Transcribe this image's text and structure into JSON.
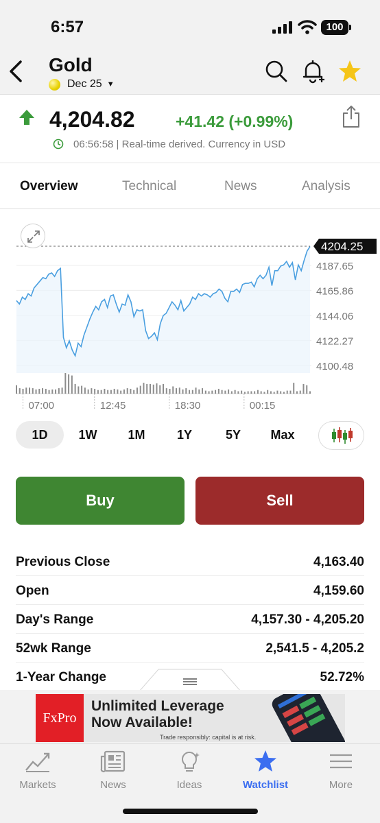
{
  "status_bar": {
    "time": "6:57",
    "battery": "100"
  },
  "header": {
    "title": "Gold",
    "contract": "Dec 25"
  },
  "quote": {
    "price": "4,204.82",
    "change": "+41.42 (+0.99%)",
    "timestamp_text": "06:56:58 | Real-time derived. Currency in USD",
    "up_color": "#3b9b3b"
  },
  "tabs": [
    {
      "label": "Overview",
      "active": true
    },
    {
      "label": "Technical",
      "active": false
    },
    {
      "label": "News",
      "active": false
    },
    {
      "label": "Analysis",
      "active": false
    }
  ],
  "chart_data": {
    "type": "line",
    "current_price_label": "4204.25",
    "y_ticks": [
      4187.65,
      4165.86,
      4144.06,
      4122.27,
      4100.48
    ],
    "ylim": [
      4094,
      4212
    ],
    "x_tick_labels": [
      "07:00",
      "12:45",
      "18:30",
      "00:15"
    ],
    "x_tick_positions": [
      0.02,
      0.24,
      0.47,
      0.7
    ],
    "series_values": [
      4157,
      4154,
      4160,
      4158,
      4163,
      4161,
      4168,
      4171,
      4174,
      4177,
      4176,
      4180,
      4181,
      4178,
      4183,
      4185,
      4125,
      4116,
      4122,
      4114,
      4109,
      4120,
      4117,
      4127,
      4134,
      4141,
      4147,
      4152,
      4149,
      4156,
      4158,
      4151,
      4161,
      4162,
      4154,
      4147,
      4154,
      4153,
      4162,
      4156,
      4143,
      4149,
      4148,
      4149,
      4131,
      4124,
      4126,
      4129,
      4123,
      4137,
      4144,
      4146,
      4151,
      4156,
      4153,
      4149,
      4157,
      4148,
      4151,
      4154,
      4160,
      4158,
      4163,
      4161,
      4163,
      4162,
      4160,
      4163,
      4164,
      4167,
      4165,
      4159,
      4156,
      4165,
      4165,
      4167,
      4164,
      4171,
      4172,
      4172,
      4173,
      4169,
      4176,
      4179,
      4176,
      4179,
      4186,
      4170,
      4183,
      4183,
      4187,
      4188,
      4191,
      4186,
      4190,
      4175,
      4188,
      4183,
      4192,
      4200,
      4204
    ],
    "volume_values": [
      14,
      9,
      8,
      10,
      10,
      9,
      7,
      8,
      9,
      8,
      6,
      7,
      7,
      9,
      10,
      34,
      32,
      30,
      16,
      12,
      13,
      10,
      7,
      9,
      8,
      6,
      6,
      8,
      6,
      6,
      8,
      7,
      5,
      7,
      9,
      8,
      6,
      10,
      13,
      18,
      16,
      16,
      15,
      17,
      14,
      16,
      9,
      8,
      12,
      9,
      10,
      7,
      9,
      6,
      6,
      10,
      7,
      9,
      5,
      4,
      5,
      6,
      8,
      6,
      5,
      7,
      4,
      6,
      4,
      5,
      3,
      4,
      4,
      4,
      6,
      4,
      3,
      6,
      4,
      3,
      5,
      4,
      3,
      5,
      5,
      18,
      4,
      5,
      16,
      14,
      4
    ],
    "line_color": "#4a9fe0",
    "grid": true
  },
  "ranges": [
    {
      "label": "1D",
      "active": true
    },
    {
      "label": "1W",
      "active": false
    },
    {
      "label": "1M",
      "active": false
    },
    {
      "label": "1Y",
      "active": false
    },
    {
      "label": "5Y",
      "active": false
    },
    {
      "label": "Max",
      "active": false
    }
  ],
  "actions": {
    "buy": "Buy",
    "sell": "Sell",
    "buy_color": "#3f8632",
    "sell_color": "#9c2b2b"
  },
  "stats": [
    {
      "label": "Previous Close",
      "value": "4,163.40"
    },
    {
      "label": "Open",
      "value": "4,159.60"
    },
    {
      "label": "Day's Range",
      "value": "4,157.30 - 4,205.20"
    },
    {
      "label": "52wk Range",
      "value": "2,541.5 - 4,205.2"
    },
    {
      "label": "1-Year Change",
      "value": "52.72%"
    }
  ],
  "ad": {
    "brand": "FxPro",
    "headline_1": "Unlimited Leverage",
    "headline_2": "Now Available!",
    "note": "Trade responsibly: capital is at risk."
  },
  "bottom_nav": [
    {
      "label": "Markets",
      "icon": "markets-chart-icon",
      "active": false
    },
    {
      "label": "News",
      "icon": "newspaper-icon",
      "active": false
    },
    {
      "label": "Ideas",
      "icon": "lightbulb-icon",
      "active": false
    },
    {
      "label": "Watchlist",
      "icon": "star-icon",
      "active": true
    },
    {
      "label": "More",
      "icon": "menu-icon",
      "active": false
    }
  ],
  "accent_color": "#3b6ef0"
}
